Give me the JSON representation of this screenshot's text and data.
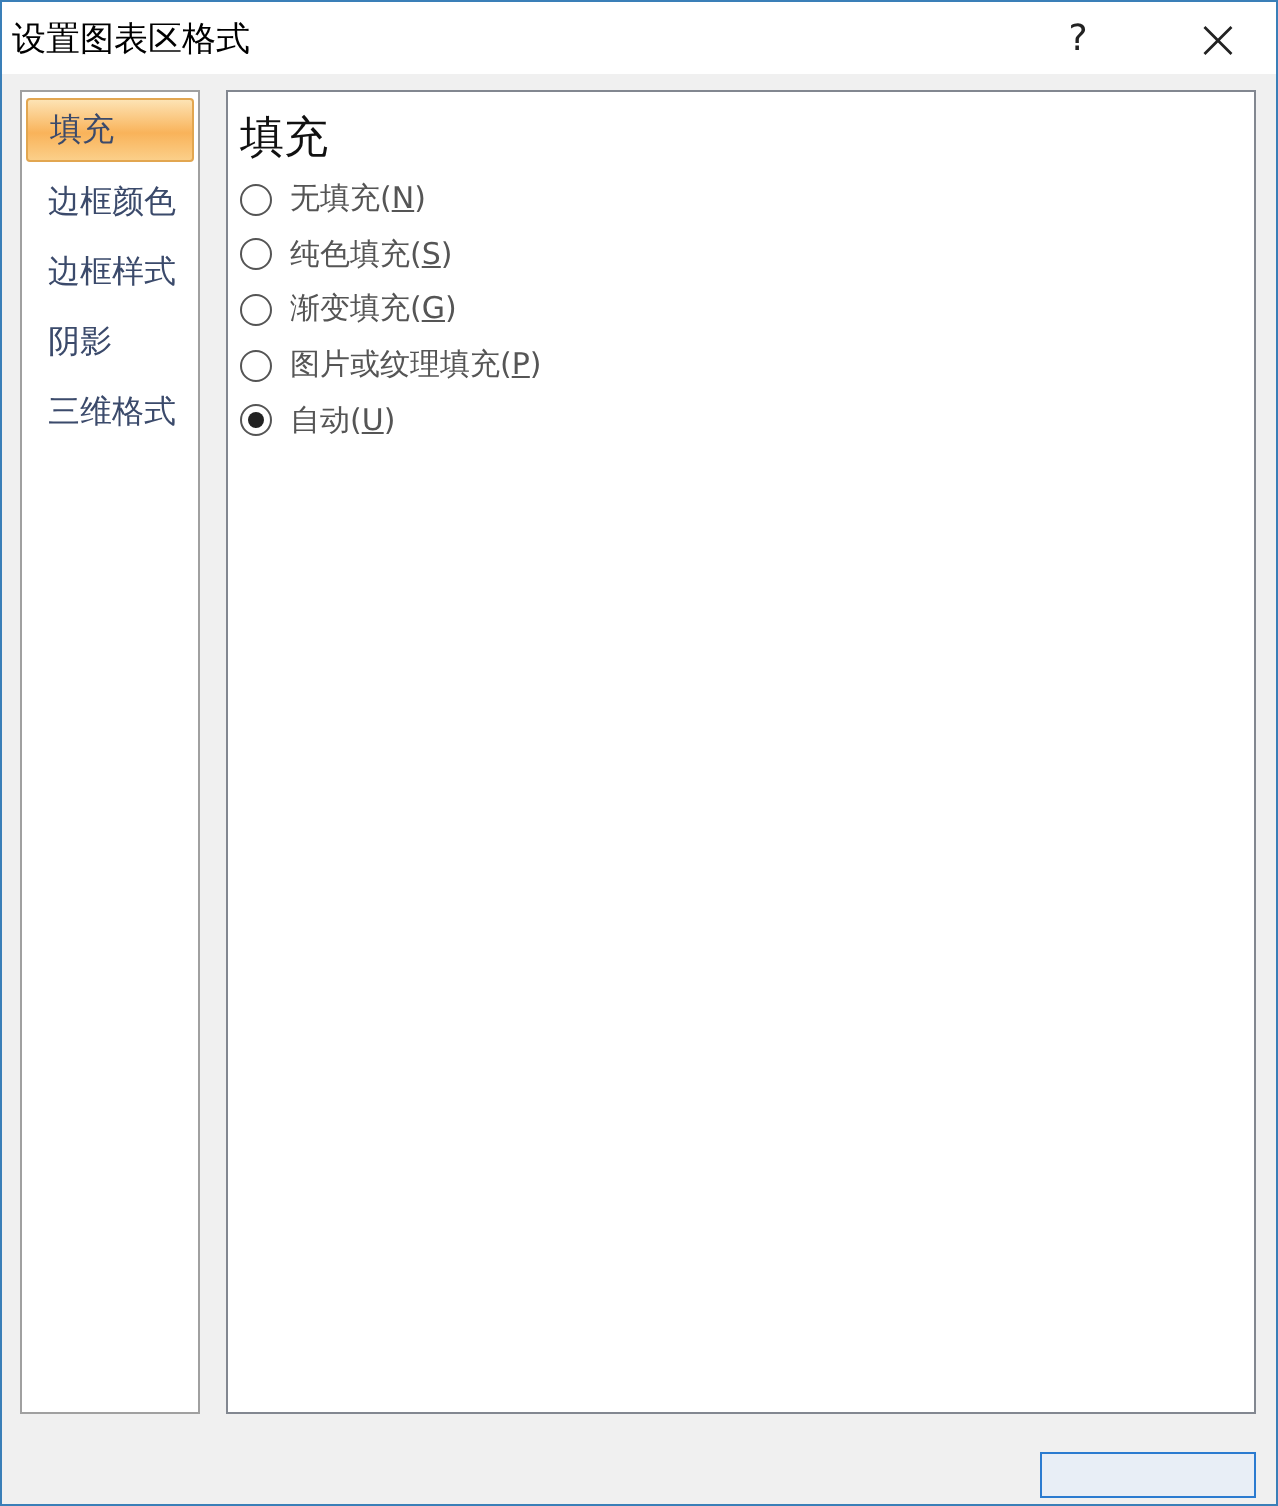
{
  "window": {
    "title": "设置图表区格式",
    "help": "?",
    "close": "×"
  },
  "sidebar": {
    "items": [
      {
        "label": "填充",
        "selected": true
      },
      {
        "label": "边框颜色",
        "selected": false
      },
      {
        "label": "边框样式",
        "selected": false
      },
      {
        "label": "阴影",
        "selected": false
      },
      {
        "label": "三维格式",
        "selected": false
      }
    ]
  },
  "panel": {
    "heading": "填充",
    "options": [
      {
        "before": "无填充(",
        "key": "N",
        "after": ")",
        "selected": false
      },
      {
        "before": "纯色填充(",
        "key": "S",
        "after": ")",
        "selected": false
      },
      {
        "before": "渐变填充(",
        "key": "G",
        "after": ")",
        "selected": false
      },
      {
        "before": "图片或纹理填充(",
        "key": "P",
        "after": ")",
        "selected": false
      },
      {
        "before": "自动(",
        "key": "U",
        "after": ")",
        "selected": true
      }
    ]
  }
}
